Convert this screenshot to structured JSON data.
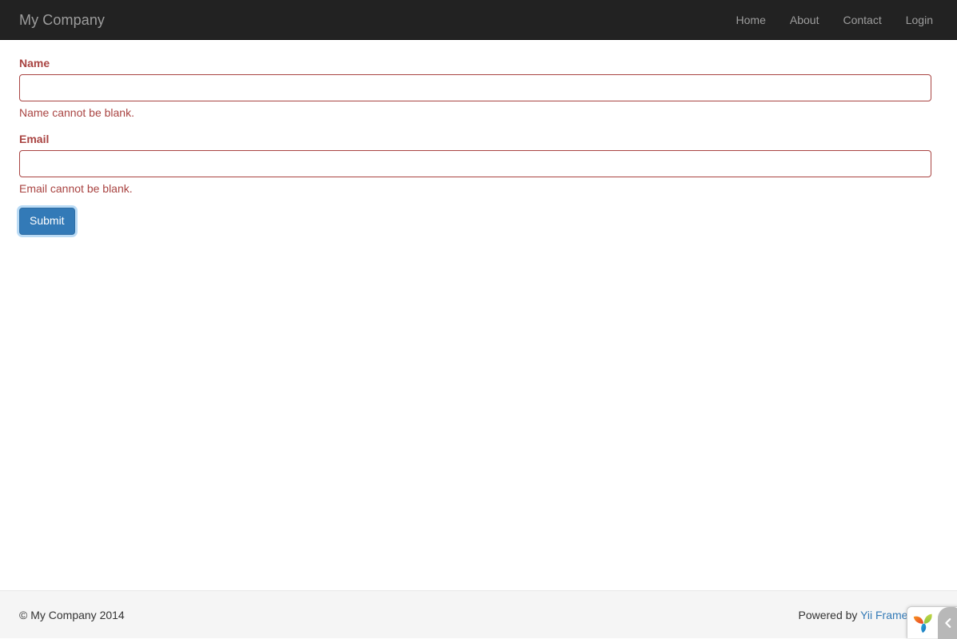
{
  "navbar": {
    "brand": "My Company",
    "links": [
      {
        "label": "Home"
      },
      {
        "label": "About"
      },
      {
        "label": "Contact"
      },
      {
        "label": "Login"
      }
    ],
    "bg_color": "#222222",
    "text_color": "#9d9d9d"
  },
  "form": {
    "fields": [
      {
        "label": "Name",
        "value": "",
        "placeholder": "",
        "error": "Name cannot be blank."
      },
      {
        "label": "Email",
        "value": "",
        "placeholder": "",
        "error": "Email cannot be blank."
      }
    ],
    "submit_label": "Submit",
    "error_color": "#a94442",
    "primary_color": "#337ab7"
  },
  "footer": {
    "copyright": "© My Company 2014",
    "powered_by_prefix": "Powered by ",
    "powered_by_link": "Yii Framework",
    "link_color": "#337ab7",
    "bg_color": "#f5f5f5"
  },
  "debug_toolbar": {
    "logo_name": "yii-logo",
    "toggle_icon": "chevron-left-icon",
    "toggle_glyph": "‹"
  }
}
